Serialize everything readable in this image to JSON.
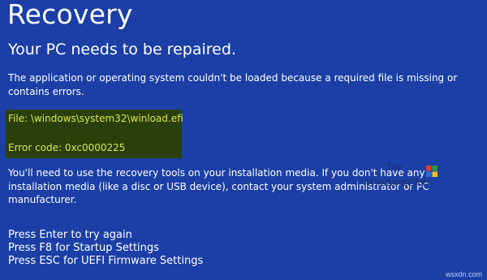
{
  "screen": {
    "title": "Recovery",
    "subtitle": "Your PC needs to be repaired.",
    "message": "The application or operating system couldn't be loaded because a required file is missing or contains errors.",
    "file_line": "File: \\windows\\system32\\winload.efi",
    "error_line": "Error code: 0xc0000225",
    "instructions": "You'll need to use the recovery tools on your installation media. If you don't have any installation media (like a disc or USB device), contact your system administrator or PC manufacturer.",
    "actions": [
      "Press Enter to try again",
      "Press F8 for Startup Settings",
      "Press ESC for UEFI Firmware Settings"
    ]
  },
  "watermark": {
    "line1": "The",
    "line2": "WindowsClub"
  },
  "corner_watermark": "wsxdn.com",
  "colors": {
    "background": "#1b3fa6",
    "highlight_bg": "#2b3f0d",
    "highlight_text": "#d8e84a",
    "text": "#ffffff"
  }
}
